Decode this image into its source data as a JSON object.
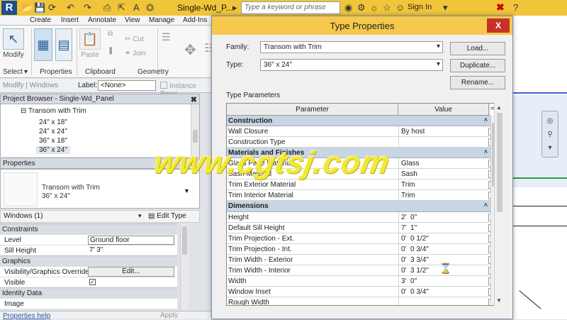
{
  "titlebar": {
    "doc_title": "Single-Wd_P...",
    "search_placeholder": "Type a keyword or phrase",
    "signin": "Sign In"
  },
  "ribbon": {
    "tabs": [
      "Create",
      "Insert",
      "Annotate",
      "View",
      "Manage",
      "Add-Ins"
    ],
    "modify_label": "Modify",
    "paste_label": "Paste",
    "cut_label": "Cut",
    "join_label": "Join",
    "panels": [
      "Select",
      "Properties",
      "Clipboard",
      "Geometry"
    ]
  },
  "optbar": {
    "context": "Modify | Windows",
    "label_caption": "Label:",
    "label_value": "<None>",
    "instance_param": "Instance Parar"
  },
  "project_browser": {
    "title": "Project Browser - Single-Wd_Panel",
    "family": "Transom with Trim",
    "types": [
      "24\" x 18\"",
      "24\" x 24\"",
      "36\" x 18\"",
      "36\" x 24\""
    ]
  },
  "properties": {
    "title": "Properties",
    "type_family": "Transom with Trim",
    "type_name": "36\" x 24\"",
    "filter": "Windows (1)",
    "edit_type": "Edit Type",
    "rows": {
      "constraints": "Constraints",
      "level_k": "Level",
      "level_v": "Ground floor",
      "sill_k": "Sill Height",
      "sill_v": "7'  3\"",
      "graphics": "Graphics",
      "vis_k": "Visibility/Graphics Overrides",
      "vis_v": "Edit...",
      "visible_k": "Visible",
      "identity": "Identity Data",
      "image_k": "Image"
    },
    "help": "Properties help",
    "apply": "Apply"
  },
  "dialog": {
    "title": "Type Properties",
    "close": "X",
    "family_label": "Family:",
    "family_value": "Transom with Trim",
    "type_label": "Type:",
    "type_value": "36\" x 24\"",
    "load": "Load...",
    "duplicate": "Duplicate...",
    "rename": "Rename...",
    "type_params": "Type Parameters",
    "col_param": "Parameter",
    "col_value": "Value",
    "col_eq": "=",
    "groups": [
      {
        "name": "Construction",
        "rows": [
          {
            "k": "Wall Closure",
            "v": "By host"
          },
          {
            "k": "Construction Type",
            "v": ""
          }
        ]
      },
      {
        "name": "Materials and Finishes",
        "rows": [
          {
            "k": "Glass Pane Material",
            "v": "Glass"
          },
          {
            "k": "Sash Material",
            "v": "Sash"
          },
          {
            "k": "Trim Exterior Material",
            "v": "Trim"
          },
          {
            "k": "Trim Interior Material",
            "v": "Trim"
          }
        ]
      },
      {
        "name": "Dimensions",
        "rows": [
          {
            "k": "Height",
            "v": "2'  0\""
          },
          {
            "k": "Default Sill Height",
            "v": "7'  1\""
          },
          {
            "k": "Trim Projection - Ext.",
            "v": "0'  0 1/2\""
          },
          {
            "k": "Trim Projection - Int.",
            "v": "0'  0 3/4\""
          },
          {
            "k": "Trim Width - Exterior",
            "v": "0'  3 3/4\""
          },
          {
            "k": "Trim Width - Interior",
            "v": "0'  3 1/2\""
          },
          {
            "k": "Width",
            "v": "3'  0\""
          },
          {
            "k": "Window Inset",
            "v": "0'  0 3/4\""
          },
          {
            "k": "Rough Width",
            "v": ""
          }
        ]
      }
    ]
  },
  "watermark": "www.cgtsj.com"
}
